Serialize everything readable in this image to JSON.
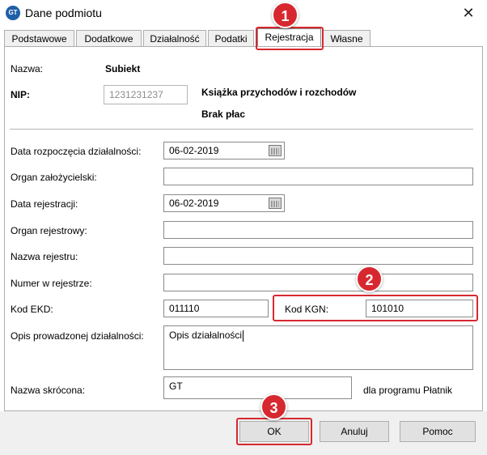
{
  "window": {
    "title": "Dane podmiotu",
    "icon_text": "GT",
    "close_glyph": "✕"
  },
  "tabs": [
    {
      "label": "Podstawowe"
    },
    {
      "label": "Dodatkowe"
    },
    {
      "label": "Działalność"
    },
    {
      "label": "Podatki"
    },
    {
      "label": "Rejestracja",
      "active": true
    },
    {
      "label": "Własne"
    }
  ],
  "header": {
    "name_label": "Nazwa:",
    "name_value": "Subiekt",
    "nip_label": "NIP:",
    "nip_value": "1231231237",
    "info_line1": "Książka przychodów i rozchodów",
    "info_line2": "Brak płac"
  },
  "form": {
    "data_rozpoczecia_label": "Data rozpoczęcia działalności:",
    "data_rozpoczecia_value": "06-02-2019",
    "organ_zalozycielski_label": "Organ założycielski:",
    "organ_zalozycielski_value": "",
    "data_rejestracji_label": "Data rejestracji:",
    "data_rejestracji_value": "06-02-2019",
    "organ_rejestrowy_label": "Organ rejestrowy:",
    "organ_rejestrowy_value": "",
    "nazwa_rejestru_label": "Nazwa rejestru:",
    "nazwa_rejestru_value": "",
    "numer_w_rejestrze_label": "Numer w rejestrze:",
    "numer_w_rejestrze_value": "",
    "kod_ekd_label": "Kod EKD:",
    "kod_ekd_value": "011110",
    "kod_kgn_label": "Kod KGN:",
    "kod_kgn_value": "101010",
    "opis_label": "Opis prowadzonej działalności:",
    "opis_value": "Opis działalności",
    "nazwa_skrocona_label": "Nazwa skrócona:",
    "nazwa_skrocona_value": "GT",
    "nazwa_skrocona_note": "dla programu Płatnik"
  },
  "buttons": {
    "ok": "OK",
    "cancel": "Anuluj",
    "help": "Pomoc"
  },
  "annotations": {
    "badge1": "1",
    "badge2": "2",
    "badge3": "3",
    "color": "#d7282f"
  }
}
